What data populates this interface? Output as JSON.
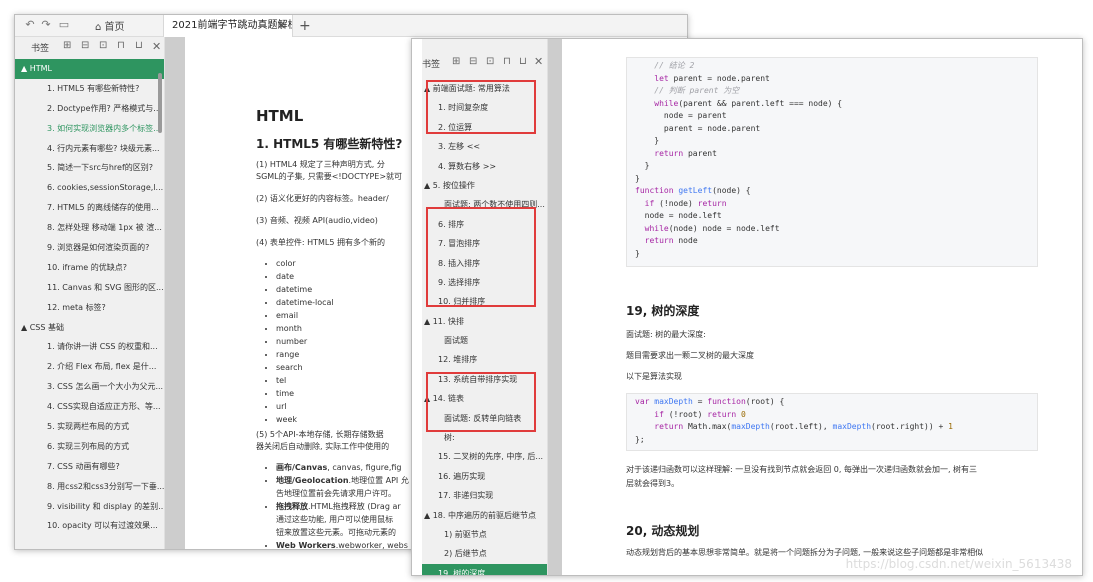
{
  "w1": {
    "home_tab": "首页",
    "doc_tab": "2021前端字节跳动真题解析",
    "side_label": "书签",
    "items": [
      "▲ HTML",
      "1. HTML5 有哪些新特性?",
      "2. Doctype作用? 严格模式与...",
      "3. 如何实现浏览器内多个标签...",
      "4. 行内元素有哪些? 块级元素...",
      "5. 简述一下src与href的区别?",
      "6. cookies,sessionStorage,l...",
      "7. HTML5 的离线储存的使用...",
      "8. 怎样处理 移动端 1px 被 渲...",
      "9. 浏览器是如何渲染页面的?",
      "10. iframe 的优缺点?",
      "11. Canvas 和 SVG 图形的区...",
      "12. meta 标签?",
      "▲ CSS 基础",
      "1. 请你讲一讲 CSS 的权重和...",
      "2. 介绍 Flex 布局, flex 是什...",
      "3. CSS 怎么画一个大小为父元...",
      "4. CSS实现自适应正方形、等...",
      "5. 实现两栏布局的方式",
      "6. 实现三列布局的方式",
      "7. CSS 动画有哪些?",
      "8. 用css2和css3分别写一下垂...",
      "9. visibility 和 display 的差别...",
      "10. opacity 可以有过渡效果..."
    ],
    "heading": "HTML",
    "subheading": "1. HTML5 有哪些新特性?",
    "p1": "(1) HTML4 规定了三种声明方式, 分",
    "p1b": "SGML的子集, 只需要<!DOCTYPE>就可",
    "p2": "(2) 语义化更好的内容标签。header/",
    "p3": "(3) 音频、视频 API(audio,video)",
    "p4": "(4) 表单控件: HTML5 拥有多个新的",
    "bullets": [
      "color",
      "date",
      "datetime",
      "datetime-local",
      "email",
      "month",
      "number",
      "range",
      "search",
      "tel",
      "time",
      "url",
      "week"
    ],
    "p5": "(5) 5个API-本地存储, 长期存储数据",
    "p5b": "器关闭后自动删除, 实际工作中使用的",
    "b2": [
      {
        "bold": "画布/Canvas",
        "text": ", canvas, figure,fig"
      },
      {
        "bold": "地理/Geolocation",
        "text": ".地理位置 API 允"
      },
      {
        "bold": "",
        "text": "告地理位置前会先请求用户许可。"
      },
      {
        "bold": "拖拽释放",
        "text": ".HTML拖拽释放 (Drag ar"
      },
      {
        "bold": "",
        "text": "通过这些功能, 用户可以使用鼠标"
      },
      {
        "bold": "",
        "text": "钮来放置这些元素。可拖动元素的"
      },
      {
        "bold": "Web Workers",
        "text": ".webworker, webs"
      }
    ]
  },
  "w2": {
    "side_label": "书签",
    "items": [
      "▲ 前端面试题: 常用算法",
      "1. 时间复杂度",
      "2. 位运算",
      "3. 左移 <<",
      "4. 算数右移 >>",
      "▲ 5. 按位操作",
      "面试题: 两个数不使用四则...",
      "6. 排序",
      "7. 冒泡排序",
      "8. 插入排序",
      "9. 选择排序",
      "10. 归并排序",
      "▲ 11. 快排",
      "面试题",
      "12. 堆排序",
      "13. 系统自带排序实现",
      "▲ 14. 链表",
      "面试题: 反转单向链表",
      "树:",
      "15. 二叉树的先序, 中序, 后...",
      "16. 遍历实现",
      "17. 非递归实现",
      "▲ 18. 中序遍历的前驱后继节点",
      "1) 前驱节点",
      "2) 后继节点",
      "19. 树的深度"
    ],
    "code1": [
      "    // 结论 2",
      "    let parent = node.parent",
      "    // 判断 parent 为空",
      "    while(parent && parent.left === node) {",
      "      node = parent",
      "      parent = node.parent",
      "    }",
      "    return parent",
      "  }",
      "}",
      "function getLeft(node) {",
      "  if (!node) return",
      "  node = node.left",
      "  while(node) node = node.left",
      "  return node",
      "}"
    ],
    "h19": "19, 树的深度",
    "q19": "面试题: 树的最大深度:",
    "d19": "题目需要求出一颗二叉树的最大深度",
    "impl": "以下是算法实现",
    "code2": [
      "var maxDepth = function(root) {",
      "    if (!root) return 0",
      "    return Math.max(maxDepth(root.left), maxDepth(root.right)) + 1",
      "};"
    ],
    "explain1": "对于该递归函数可以这样理解: 一旦没有找到节点就会返回 0, 每弹出一次递归函数就会加一, 树有三",
    "explain2": "层就会得到3。",
    "h20": "20, 动态规划",
    "p20": "动态规划背后的基本思想非常简单。就是将一个问题拆分为子问题, 一般来说这些子问题都是非常相似",
    "watermark": "https://blog.csdn.net/weixin_5613438"
  }
}
